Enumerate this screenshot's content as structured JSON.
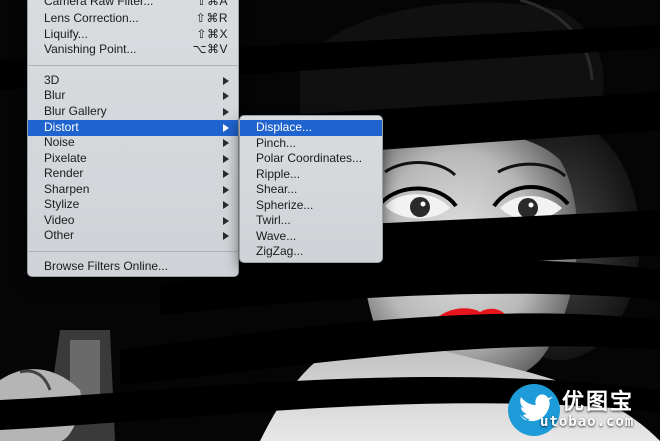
{
  "filter_menu": {
    "items": [
      {
        "label": "Camera Raw Filter...",
        "shortcut": "⇧⌘A"
      },
      {
        "label": "Lens Correction...",
        "shortcut": "⇧⌘R"
      },
      {
        "label": "Liquify...",
        "shortcut": "⇧⌘X"
      },
      {
        "label": "Vanishing Point...",
        "shortcut": "⌥⌘V"
      },
      {
        "label": "3D",
        "submenu": true
      },
      {
        "label": "Blur",
        "submenu": true
      },
      {
        "label": "Blur Gallery",
        "submenu": true
      },
      {
        "label": "Distort",
        "submenu": true,
        "highlighted": true
      },
      {
        "label": "Noise",
        "submenu": true
      },
      {
        "label": "Pixelate",
        "submenu": true
      },
      {
        "label": "Render",
        "submenu": true
      },
      {
        "label": "Sharpen",
        "submenu": true
      },
      {
        "label": "Stylize",
        "submenu": true
      },
      {
        "label": "Video",
        "submenu": true
      },
      {
        "label": "Other",
        "submenu": true
      },
      {
        "label": "Browse Filters Online..."
      }
    ]
  },
  "distort_submenu": {
    "items": [
      {
        "label": "Displace...",
        "highlighted": true
      },
      {
        "label": "Pinch..."
      },
      {
        "label": "Polar Coordinates..."
      },
      {
        "label": "Ripple..."
      },
      {
        "label": "Shear..."
      },
      {
        "label": "Spherize..."
      },
      {
        "label": "Twirl..."
      },
      {
        "label": "Wave..."
      },
      {
        "label": "ZigZag..."
      }
    ]
  },
  "watermark": {
    "cn": "优图宝",
    "en": "utobao.com"
  },
  "colors": {
    "highlight": "#1f63cf",
    "menu_bg": "#d3d6da",
    "lips": "#e8141c",
    "watermark_blue": "#1d9bd8"
  }
}
